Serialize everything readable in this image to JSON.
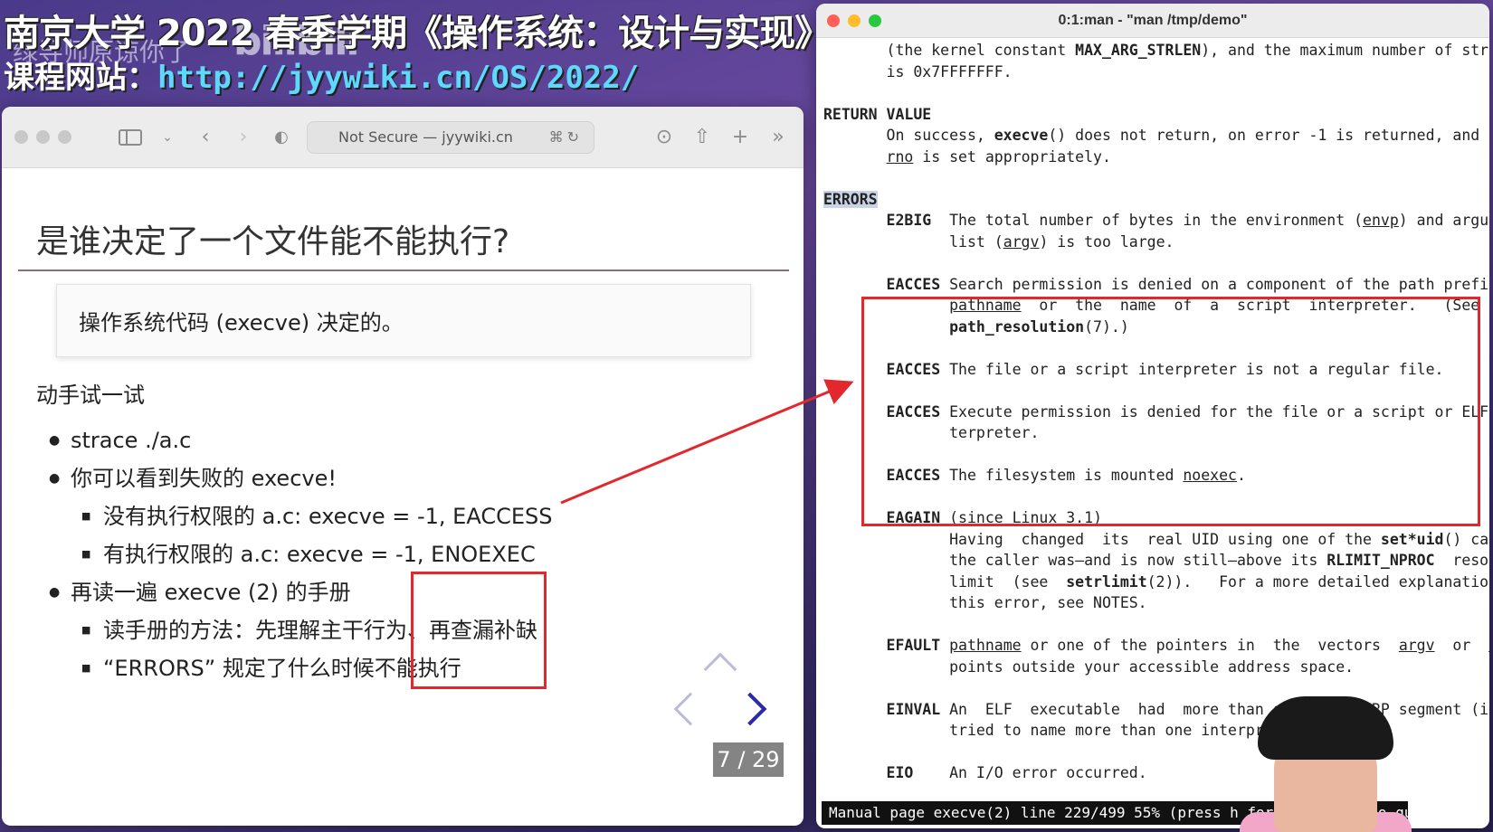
{
  "overlay": {
    "title": "南京大学 2022 春季学期《操作系统：设计与实现》",
    "url_label": "课程网站：",
    "url": "http://jyywiki.cn/OS/2022/",
    "watermark": "绿导师原谅你了",
    "logo": "bilibili"
  },
  "browser": {
    "url_text": "Not Secure — jyywiki.cn",
    "slide": {
      "heading": "是谁决定了一个文件能不能执行?",
      "box_text": "操作系统代码 (execve) 决定的。",
      "subheading": "动手试一试",
      "bullets": [
        "strace ./a.c",
        "你可以看到失败的 execve!",
        "再读一遍 execve (2) 的手册"
      ],
      "sub_bullets_1": [
        "没有执行权限的 a.c: execve = -1, EACCESS",
        "有执行权限的 a.c: execve = -1, ENOEXEC"
      ],
      "sub_bullets_2": [
        "读手册的方法：先理解主干行为、再查漏补缺",
        "“ERRORS” 规定了什么时候不能执行"
      ],
      "page_indicator": "7 / 29"
    }
  },
  "terminal": {
    "title": "0:1:man - \"man /tmp/demo\"",
    "status": "Manual page execve(2) line 229/499 55% (press h for help or q to quit)"
  },
  "colors": {
    "highlight_red": "#e2282d",
    "url_cyan": "#5fd8ff",
    "nav_blue": "#2a2ab0"
  }
}
